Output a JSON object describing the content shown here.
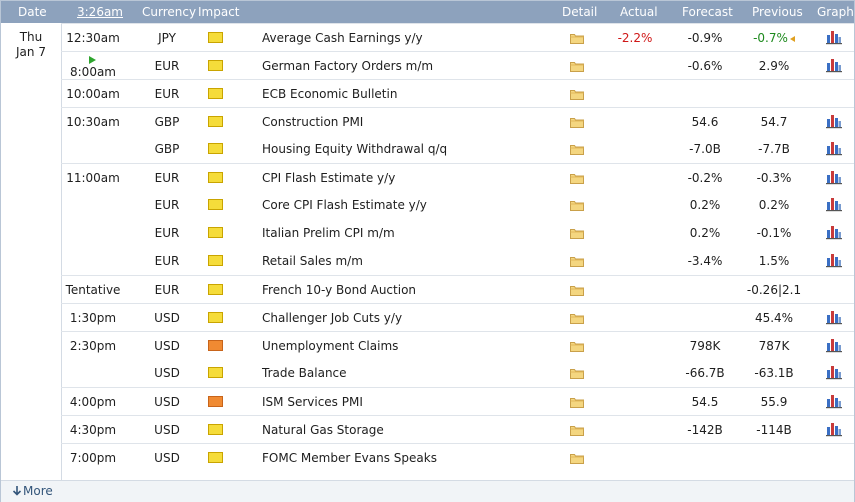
{
  "header": {
    "date": "Date",
    "time": "3:26am",
    "currency": "Currency",
    "impact": "Impact",
    "detail": "Detail",
    "actual": "Actual",
    "forecast": "Forecast",
    "previous": "Previous",
    "graph": "Graph"
  },
  "date": {
    "day": "Thu",
    "date": "Jan 7"
  },
  "events": [
    {
      "time": "12:30am",
      "currency": "JPY",
      "impact": "medium",
      "title": "Average Cash Earnings y/y",
      "actual": "-2.2%",
      "actual_color": "red",
      "forecast": "-0.9%",
      "previous": "-0.7%",
      "previous_color": "green",
      "previous_revised": true,
      "graph": true
    },
    {
      "time": "8:00am",
      "currency": "EUR",
      "impact": "medium",
      "title": "German Factory Orders m/m",
      "actual": "",
      "forecast": "-0.6%",
      "previous": "2.9%",
      "graph": true,
      "upnext": true
    },
    {
      "time": "10:00am",
      "currency": "EUR",
      "impact": "medium",
      "title": "ECB Economic Bulletin",
      "actual": "",
      "forecast": "",
      "previous": "",
      "graph": false
    },
    {
      "time": "10:30am",
      "currency": "GBP",
      "impact": "medium",
      "title": "Construction PMI",
      "actual": "",
      "forecast": "54.6",
      "previous": "54.7",
      "graph": true
    },
    {
      "time": "",
      "currency": "GBP",
      "impact": "medium",
      "title": "Housing Equity Withdrawal q/q",
      "actual": "",
      "forecast": "-7.0B",
      "previous": "-7.7B",
      "graph": true
    },
    {
      "time": "11:00am",
      "currency": "EUR",
      "impact": "medium",
      "title": "CPI Flash Estimate y/y",
      "actual": "",
      "forecast": "-0.2%",
      "previous": "-0.3%",
      "graph": true
    },
    {
      "time": "",
      "currency": "EUR",
      "impact": "medium",
      "title": "Core CPI Flash Estimate y/y",
      "actual": "",
      "forecast": "0.2%",
      "previous": "0.2%",
      "graph": true
    },
    {
      "time": "",
      "currency": "EUR",
      "impact": "medium",
      "title": "Italian Prelim CPI m/m",
      "actual": "",
      "forecast": "0.2%",
      "previous": "-0.1%",
      "graph": true
    },
    {
      "time": "",
      "currency": "EUR",
      "impact": "medium",
      "title": "Retail Sales m/m",
      "actual": "",
      "forecast": "-3.4%",
      "previous": "1.5%",
      "graph": true
    },
    {
      "time": "Tentative",
      "currency": "EUR",
      "impact": "medium",
      "title": "French 10-y Bond Auction",
      "actual": "",
      "forecast": "",
      "previous": "-0.26|2.1",
      "graph": false
    },
    {
      "time": "1:30pm",
      "currency": "USD",
      "impact": "medium",
      "title": "Challenger Job Cuts y/y",
      "actual": "",
      "forecast": "",
      "previous": "45.4%",
      "graph": true
    },
    {
      "time": "2:30pm",
      "currency": "USD",
      "impact": "high",
      "title": "Unemployment Claims",
      "actual": "",
      "forecast": "798K",
      "previous": "787K",
      "graph": true
    },
    {
      "time": "",
      "currency": "USD",
      "impact": "medium",
      "title": "Trade Balance",
      "actual": "",
      "forecast": "-66.7B",
      "previous": "-63.1B",
      "graph": true
    },
    {
      "time": "4:00pm",
      "currency": "USD",
      "impact": "high",
      "title": "ISM Services PMI",
      "actual": "",
      "forecast": "54.5",
      "previous": "55.9",
      "graph": true
    },
    {
      "time": "4:30pm",
      "currency": "USD",
      "impact": "medium",
      "title": "Natural Gas Storage",
      "actual": "",
      "forecast": "-142B",
      "previous": "-114B",
      "graph": true
    },
    {
      "time": "7:00pm",
      "currency": "USD",
      "impact": "medium",
      "title": "FOMC Member Evans Speaks",
      "actual": "",
      "forecast": "",
      "previous": "",
      "graph": false
    }
  ],
  "footer": {
    "more": "More"
  },
  "colors": {
    "header_bg": "#8da2bd",
    "impact_medium": "#f5dc3a",
    "impact_high": "#f08a32",
    "actual_red": "#d01818",
    "previous_green": "#1e8a1e"
  }
}
